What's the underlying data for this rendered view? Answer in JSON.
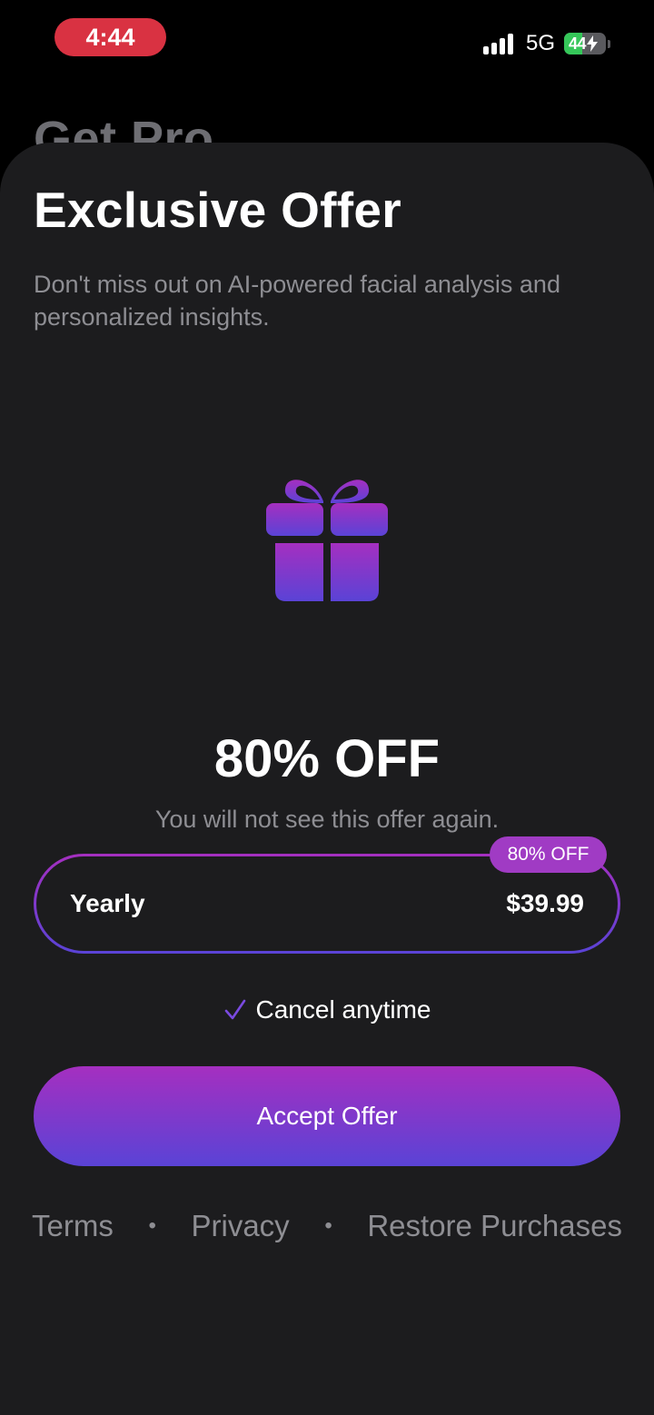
{
  "status_bar": {
    "time": "4:44",
    "network": "5G",
    "battery_level": "44",
    "battery_fraction": 0.44,
    "time_pill_color": "#d93242",
    "battery_color": "#35c759"
  },
  "background": {
    "title": "Get Pro"
  },
  "offer_sheet": {
    "title": "Exclusive Offer",
    "subtitle": "Don't miss out on AI-powered facial analysis and personalized insights.",
    "icon": "gift-icon",
    "headline": "80% OFF",
    "note": "You will not see this offer again.",
    "plan": {
      "name": "Yearly",
      "price": "$39.99",
      "badge": "80% OFF"
    },
    "cancel_text": "Cancel anytime",
    "cta_label": "Accept Offer",
    "accent_gradient": [
      "#a52fc0",
      "#5a43d6"
    ]
  },
  "footer": {
    "links": [
      "Terms",
      "Privacy",
      "Restore Purchases"
    ],
    "separator": "•"
  }
}
